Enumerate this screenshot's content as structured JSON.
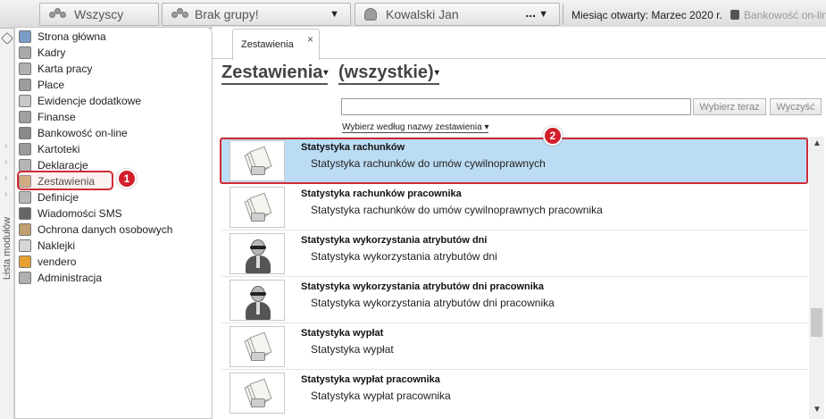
{
  "topbar": {
    "all_label": "Wszyscy",
    "group_label": "Brak grupy!",
    "person_label": "Kowalski Jan",
    "person_more": "...",
    "month_label": "Miesiąc otwarty:",
    "month_value": "Marzec 2020 r.",
    "bank_label": "Bankowość on-lin"
  },
  "sidebar": {
    "vertical_label": "Lista modułów",
    "items": [
      {
        "label": "Strona główna",
        "icon": "home-icon",
        "color": "#7a9cc9"
      },
      {
        "label": "Kadry",
        "icon": "people-icon",
        "color": "#a9a9a9"
      },
      {
        "label": "Karta pracy",
        "icon": "clock-icon",
        "color": "#b0b0b0"
      },
      {
        "label": "Płace",
        "icon": "wallet-icon",
        "color": "#9c9c9c"
      },
      {
        "label": "Ewidencje dodatkowe",
        "icon": "eraser-icon",
        "color": "#c8c8c8"
      },
      {
        "label": "Finanse",
        "icon": "finance-icon",
        "color": "#a0a0a0"
      },
      {
        "label": "Bankowość on-line",
        "icon": "bank-icon",
        "color": "#8a8a8a"
      },
      {
        "label": "Kartoteki",
        "icon": "folder-icon",
        "color": "#9a9a9a"
      },
      {
        "label": "Deklaracje",
        "icon": "declaration-icon",
        "color": "#b5b5b5"
      },
      {
        "label": "Zestawienia",
        "icon": "report-icon",
        "color": "#c9a36a"
      },
      {
        "label": "Definicje",
        "icon": "definitions-icon",
        "color": "#b8b8b8"
      },
      {
        "label": "Wiadomości SMS",
        "icon": "sms-icon",
        "color": "#666666"
      },
      {
        "label": "Ochrona danych osobowych",
        "icon": "shield-icon",
        "color": "#c0a070"
      },
      {
        "label": "Naklejki",
        "icon": "sticker-icon",
        "color": "#d6d6d6"
      },
      {
        "label": "vendero",
        "icon": "vendero-icon",
        "color": "#e8a030"
      },
      {
        "label": "Administracja",
        "icon": "admin-icon",
        "color": "#b0b0b0"
      }
    ],
    "badge": "1"
  },
  "tab": {
    "label": "Zestawienia",
    "close": "×"
  },
  "heading": {
    "main": "Zestawienia",
    "filter": "(wszystkie)",
    "dd_arrow": "▾"
  },
  "toolbar": {
    "search_value": "",
    "select_button": "Wybierz teraz",
    "clear_button": "Wyczyść",
    "filter_link": "Wybierz według nazwy zestawienia",
    "filter_arrow": "▾"
  },
  "list": {
    "badge": "2",
    "rows": [
      {
        "title": "Statystyka rachunków",
        "desc": "Statystyka rachunków do umów cywilnoprawnych",
        "icon": "paper-stack-icon",
        "selected": true
      },
      {
        "title": "Statystyka rachunków pracownika",
        "desc": "Statystyka rachunków do umów cywilnoprawnych pracownika",
        "icon": "paper-stack-icon",
        "selected": false
      },
      {
        "title": "Statystyka wykorzystania atrybutów dni",
        "desc": "Statystyka wykorzystania atrybutów dni",
        "icon": "agent-icon",
        "selected": false
      },
      {
        "title": "Statystyka wykorzystania atrybutów dni pracownika",
        "desc": "Statystyka wykorzystania atrybutów dni pracownika",
        "icon": "agent-icon",
        "selected": false
      },
      {
        "title": "Statystyka wypłat",
        "desc": "Statystyka wypłat",
        "icon": "paper-stack-icon",
        "selected": false
      },
      {
        "title": "Statystyka wypłat pracownika",
        "desc": "Statystyka wypłat pracownika",
        "icon": "paper-stack-icon",
        "selected": false
      }
    ]
  },
  "colors": {
    "selection": "#bcdcf4",
    "highlight": "#d02c36",
    "badge": "#d31f2c"
  }
}
